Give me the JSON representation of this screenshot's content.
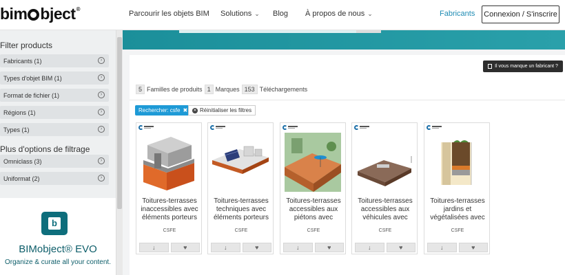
{
  "nav": {
    "logo": "bimobject",
    "items": [
      {
        "label": "Parcourir les objets BIM",
        "chevron": false
      },
      {
        "label": "Solutions",
        "chevron": true
      },
      {
        "label": "Blog",
        "chevron": false
      },
      {
        "label": "À propos de nous",
        "chevron": true
      }
    ],
    "fabricants": "Fabricants",
    "login": "Connexion / S'inscrire"
  },
  "sidebar": {
    "filter_title": "Filter products",
    "filters": [
      "Fabricants (1)",
      "Types d'objet BIM (1)",
      "Format de fichier (1)",
      "Régions (1)",
      "Types (1)"
    ],
    "more_title": "Plus d'options de filtrage",
    "more_filters": [
      "Omniclass (3)",
      "Uniformat (2)"
    ],
    "promo_title": "BIMobject® EVO",
    "promo_sub": "Organize & curate all your content.",
    "promo_icon_letter": "b"
  },
  "main": {
    "missing_btn": "Il vous manque un fabricant ?",
    "stats": {
      "families_count": "5",
      "families_label": "Familles de produits",
      "brands_count": "1",
      "brands_label": "Marques",
      "downloads_count": "153",
      "downloads_label": "Téléchargements"
    },
    "search_tag": "Rechercher: csfe",
    "reset": "Réinitialiser les filtres",
    "cards": [
      {
        "title": "Toitures-terrasses inaccessibles avec éléments porteurs",
        "brand": "CSFE"
      },
      {
        "title": "Toitures-terrasses techniques avec éléments porteurs",
        "brand": "CSFE"
      },
      {
        "title": "Toitures-terrasses accessibles aux piétons avec",
        "brand": "CSFE"
      },
      {
        "title": "Toitures-terrasses accessibles aux véhicules avec",
        "brand": "CSFE"
      },
      {
        "title": "Toitures-terrasses jardins et végétalisées avec",
        "brand": "CSFE"
      }
    ]
  },
  "colors": {
    "accent": "#1e8bb3",
    "hero": "#1b8f9a",
    "tag": "#1e9ad6",
    "evo": "#0e6e7c"
  }
}
